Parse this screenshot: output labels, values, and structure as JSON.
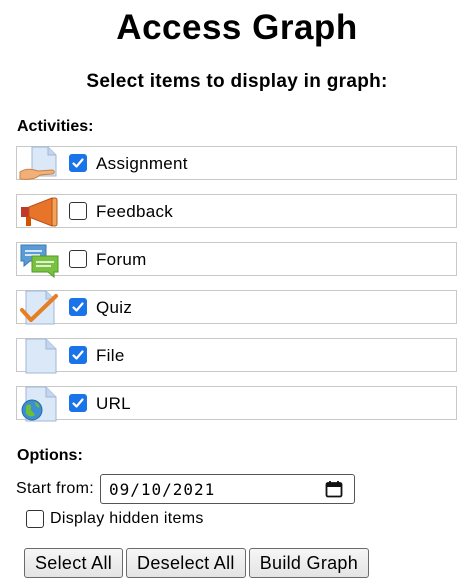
{
  "header": {
    "title": "Access Graph",
    "subtitle": "Select items to display in graph:"
  },
  "activities": {
    "label": "Activities:",
    "items": [
      {
        "label": "Assignment",
        "checked": true,
        "icon": "assignment-icon"
      },
      {
        "label": "Feedback",
        "checked": false,
        "icon": "megaphone-icon"
      },
      {
        "label": "Forum",
        "checked": false,
        "icon": "forum-icon"
      },
      {
        "label": "Quiz",
        "checked": true,
        "icon": "quiz-icon"
      },
      {
        "label": "File",
        "checked": true,
        "icon": "file-icon"
      },
      {
        "label": "URL",
        "checked": true,
        "icon": "url-globe-icon"
      }
    ]
  },
  "options": {
    "label": "Options:",
    "start_from_label": "Start from:",
    "start_date": "09/10/2021",
    "display_hidden_label": "Display hidden items",
    "display_hidden_checked": false
  },
  "buttons": {
    "select_all": "Select All",
    "deselect_all": "Deselect All",
    "build_graph": "Build Graph"
  },
  "colors": {
    "checkbox_accent": "#1a73e8",
    "row_border": "#c8c8c8"
  }
}
